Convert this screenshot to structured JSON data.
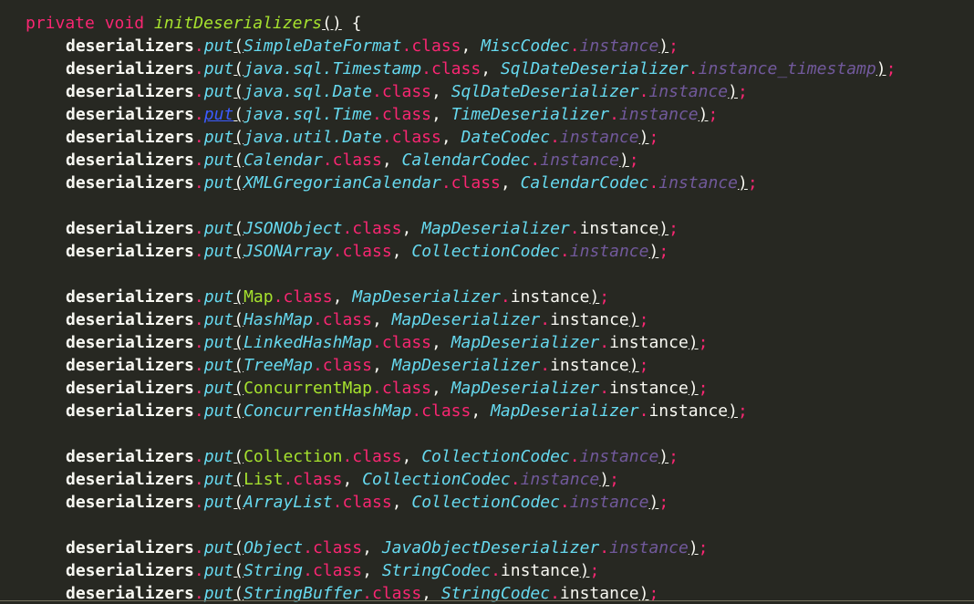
{
  "signature": {
    "modifiers": "private void ",
    "name": "initDeserializers",
    "parens": "()",
    "brace": " {"
  },
  "common": {
    "var": "deserializers",
    "dot": ".",
    "put": "put",
    "open": "(",
    "classkw": ".class",
    "comma": ", ",
    "dot2": ".",
    "close": ")",
    "semi": ";"
  },
  "lines": [
    {
      "arg": "SimpleDateFormat",
      "argStyle": "i",
      "codec": "MiscCodec",
      "inst": "instance",
      "instStyle": "dim"
    },
    {
      "arg": "java.sql.Timestamp",
      "argStyle": "i",
      "codec": "SqlDateDeserializer",
      "inst": "instance_timestamp",
      "instStyle": "dim"
    },
    {
      "arg": "java.sql.Date",
      "argStyle": "i",
      "codec": "SqlDateDeserializer",
      "inst": "instance",
      "instStyle": "dim"
    },
    {
      "arg": "java.sql.Time",
      "argStyle": "i",
      "codec": "TimeDeserializer",
      "inst": "instance",
      "instStyle": "dim",
      "putSel": true
    },
    {
      "arg": "java.util.Date",
      "argStyle": "i",
      "codec": "DateCodec",
      "inst": "instance",
      "instStyle": "dim"
    },
    {
      "arg": "Calendar",
      "argStyle": "i",
      "codec": "CalendarCodec",
      "inst": "instance",
      "instStyle": "dim"
    },
    {
      "arg": "XMLGregorianCalendar",
      "argStyle": "i",
      "codec": "CalendarCodec",
      "inst": "instance",
      "instStyle": "dim"
    },
    {
      "blank": true
    },
    {
      "arg": "JSONObject",
      "argStyle": "i",
      "codec": "MapDeserializer",
      "inst": "instance",
      "instStyle": "plain"
    },
    {
      "arg": "JSONArray",
      "argStyle": "i",
      "codec": "CollectionCodec",
      "inst": "instance",
      "instStyle": "dim"
    },
    {
      "blank": true
    },
    {
      "arg": "Map",
      "argStyle": "g",
      "codec": "MapDeserializer",
      "inst": "instance",
      "instStyle": "plain"
    },
    {
      "arg": "HashMap",
      "argStyle": "i",
      "codec": "MapDeserializer",
      "inst": "instance",
      "instStyle": "plain"
    },
    {
      "arg": "LinkedHashMap",
      "argStyle": "i",
      "codec": "MapDeserializer",
      "inst": "instance",
      "instStyle": "plain"
    },
    {
      "arg": "TreeMap",
      "argStyle": "i",
      "codec": "MapDeserializer",
      "inst": "instance",
      "instStyle": "plain"
    },
    {
      "arg": "ConcurrentMap",
      "argStyle": "g",
      "codec": "MapDeserializer",
      "inst": "instance",
      "instStyle": "plain"
    },
    {
      "arg": "ConcurrentHashMap",
      "argStyle": "i",
      "codec": "MapDeserializer",
      "inst": "instance",
      "instStyle": "plain"
    },
    {
      "blank": true
    },
    {
      "arg": "Collection",
      "argStyle": "g",
      "codec": "CollectionCodec",
      "inst": "instance",
      "instStyle": "dim"
    },
    {
      "arg": "List",
      "argStyle": "g",
      "codec": "CollectionCodec",
      "inst": "instance",
      "instStyle": "dim"
    },
    {
      "arg": "ArrayList",
      "argStyle": "i",
      "codec": "CollectionCodec",
      "inst": "instance",
      "instStyle": "dim"
    },
    {
      "blank": true
    },
    {
      "arg": "Object",
      "argStyle": "i",
      "codec": "JavaObjectDeserializer",
      "inst": "instance",
      "instStyle": "dim"
    },
    {
      "arg": "String",
      "argStyle": "i",
      "codec": "StringCodec",
      "inst": "instance",
      "instStyle": "plain"
    },
    {
      "arg": "StringBuffer",
      "argStyle": "i",
      "codec": "StringCodec",
      "inst": "instance",
      "instStyle": "plain"
    }
  ]
}
